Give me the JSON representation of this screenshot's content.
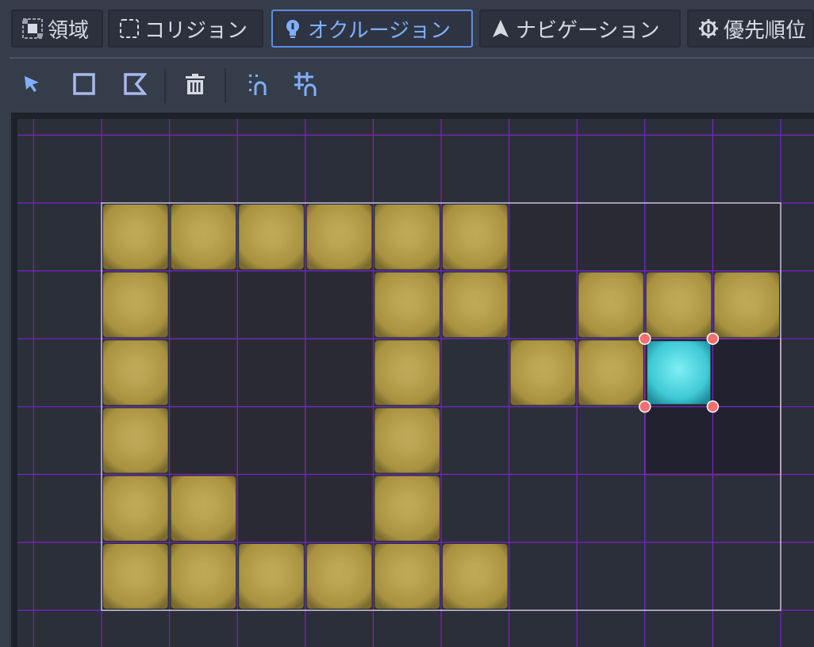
{
  "tabs": [
    {
      "label": "領域",
      "icon": "region-grid-icon",
      "active": false
    },
    {
      "label": "コリジョン",
      "icon": "collision-shape-icon",
      "active": false
    },
    {
      "label": "オクルージョン",
      "icon": "occlusion-bulb-icon",
      "active": true
    },
    {
      "label": "ナビゲーション",
      "icon": "navigation-arrow-icon",
      "active": false
    },
    {
      "label": "優先順位",
      "icon": "priority-gear-icon",
      "active": false
    }
  ],
  "tools": [
    {
      "name": "select-tool-icon"
    },
    {
      "name": "rectangle-tool-icon"
    },
    {
      "name": "polygon-tool-icon"
    },
    {
      "name": "delete-tool-icon"
    },
    {
      "name": "keep-inside-tile-icon"
    },
    {
      "name": "grid-snap-icon"
    }
  ],
  "colors": {
    "accent": "#5b8ddd",
    "tile_fill": "#a89240",
    "tile_highlight": "#c6ae5c",
    "selected_tile": "#3fc9d6",
    "grid_line": "#7a22c8",
    "sub_grid_line": "#4fbfae",
    "handle": "#f07070",
    "empty_cell": "#2a2a35",
    "selection_border": "#e05a4a"
  },
  "tilemap": {
    "columns": 10,
    "rows": 6,
    "map": [
      "111111....",
      "1...11.111",
      "1...1.11S.",
      "1...1.....",
      "11..1.....",
      "111111...."
    ],
    "dark_regions": [
      {
        "row": 0,
        "col_from": 6,
        "col_to": 9
      },
      {
        "row": 1,
        "col_from": 1,
        "col_to": 3
      },
      {
        "row": 1,
        "col_from": 6,
        "col_to": 6
      },
      {
        "row": 2,
        "col_from": 1,
        "col_to": 3
      },
      {
        "row": 3,
        "col_from": 1,
        "col_to": 3
      },
      {
        "row": 4,
        "col_from": 2,
        "col_to": 3
      }
    ],
    "selected_cell": {
      "row": 2,
      "col": 8
    },
    "selection_region": {
      "row_from": 2,
      "row_to": 3,
      "col_from": 8,
      "col_to": 9
    }
  }
}
